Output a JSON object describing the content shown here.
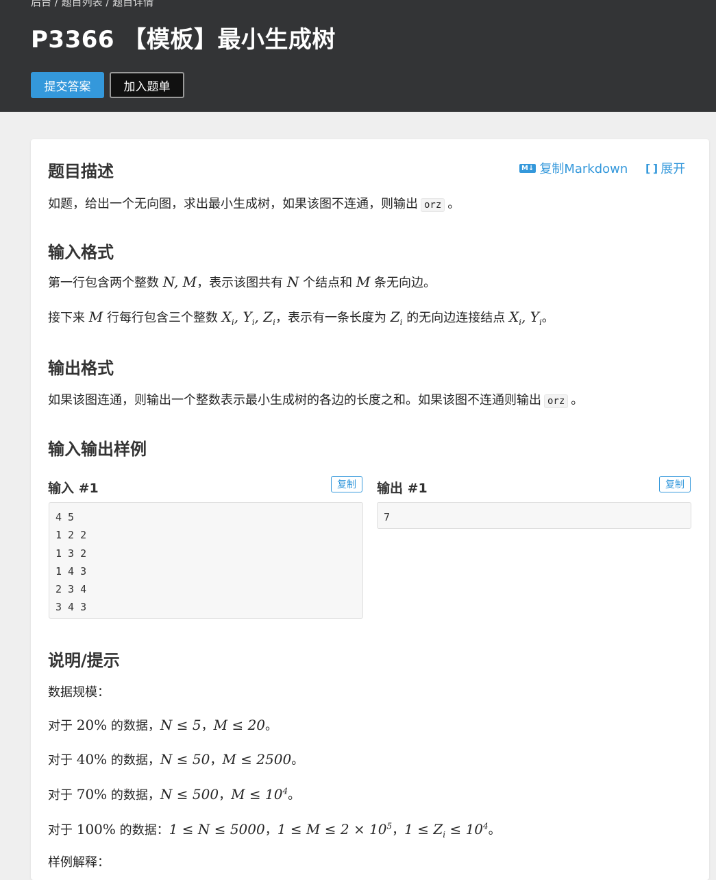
{
  "header": {
    "breadcrumb": "后台 / 题目列表 / 题目详情",
    "title": "P3366 【模板】最小生成树",
    "submit_label": "提交答案",
    "add_label": "加入题单"
  },
  "tools": {
    "markdown_badge": "M↓",
    "copy_markdown": "复制Markdown",
    "expand": "展开"
  },
  "description": {
    "title": "题目描述",
    "text": "如题，给出一个无向图，求出最小生成树，如果该图不连通，则输出",
    "code": "orz",
    "end": "。"
  },
  "input_format": {
    "title": "输入格式",
    "l1": {
      "a": "第一行包含两个整数 ",
      "m1": "N, M",
      "b": "，表示该图共有 ",
      "m2": "N",
      "c": " 个结点和 ",
      "m3": "M",
      "d": " 条无向边。"
    },
    "l2": {
      "a": "接下来 ",
      "m1": "M",
      "b": " 行每行包含三个整数 ",
      "m2": "X",
      "s2": "i",
      "m3": ", Y",
      "s3": "i",
      "m4": ", Z",
      "s4": "i",
      "c": "，表示有一条长度为 ",
      "m5": "Z",
      "s5": "i",
      "d": " 的无向边连接结点 ",
      "m6": "X",
      "s6": "i",
      "m7": ", Y",
      "s7": "i",
      "e": "。"
    }
  },
  "output_format": {
    "title": "输出格式",
    "text": "如果该图连通，则输出一个整数表示最小生成树的各边的长度之和。如果该图不连通则输出",
    "code": "orz",
    "end": "。"
  },
  "samples": {
    "title": "输入输出样例",
    "input_label": "输入 #1",
    "output_label": "输出 #1",
    "copy": "复制",
    "input": "4 5\n1 2 2\n1 3 2\n1 4 3\n2 3 4\n3 4 3",
    "output": "7"
  },
  "hint": {
    "title": "说明/提示",
    "scale": "数据规模：",
    "r1": {
      "a": "对于 ",
      "m1": "20%",
      "b": " 的数据，",
      "m2": "N ≤ 5",
      "c": "，",
      "m3": "M ≤ 20",
      "d": "。"
    },
    "r2": {
      "a": "对于 ",
      "m1": "40%",
      "b": " 的数据，",
      "m2": "N ≤ 50",
      "c": "，",
      "m3": "M ≤ 2500",
      "d": "。"
    },
    "r3": {
      "a": "对于 ",
      "m1": "70%",
      "b": " 的数据，",
      "m2": "N ≤ 500",
      "c": "，",
      "m3": "M ≤ 10",
      "sup3": "4",
      "d": "。"
    },
    "r4": {
      "a": "对于 ",
      "m1": "100%",
      "b": " 的数据：",
      "m2": "1 ≤ N ≤ 5000",
      "c": "，",
      "m3": "1 ≤ M ≤ 2 × 10",
      "sup3": "5",
      "e": "，",
      "m4": "1 ≤ Z",
      "sub4": "i",
      "m4b": " ≤ 10",
      "sup4": "4",
      "d": "。"
    },
    "cut": "样例解释："
  }
}
